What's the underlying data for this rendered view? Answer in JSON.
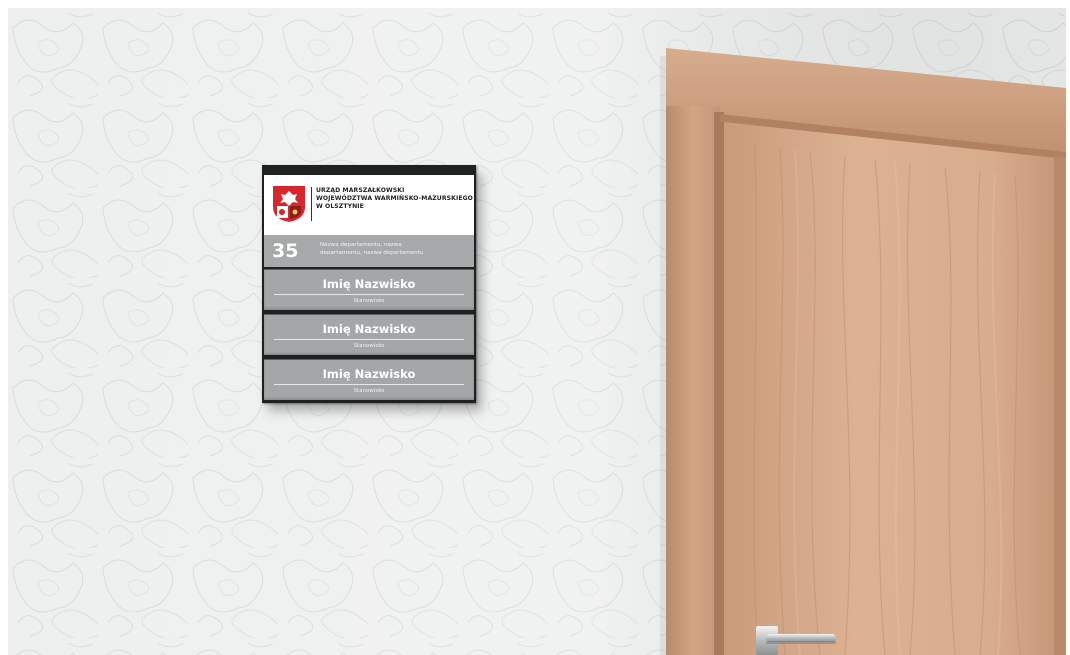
{
  "sign": {
    "institution_lines": [
      "URZĄD MARSZAŁKOWSKI",
      "WOJEWÓDZTWA WARMIŃSKO-MAZURSKIEGO",
      "W OLSZTYNIE"
    ],
    "room_number": "35",
    "department_lines": [
      "Nazwa departamentu, nazwa",
      "departamentu, nazwa departamentu"
    ],
    "panels": [
      {
        "name": "Imię Nazwisko",
        "role": "Stanowisko"
      },
      {
        "name": "Imię Nazwisko",
        "role": "Stanowisko"
      },
      {
        "name": "Imię Nazwisko",
        "role": "Stanowisko"
      }
    ]
  },
  "colors": {
    "wall": "#eef0ef",
    "sign_frame": "#1f2022",
    "panel_gray": "#a4a6a8",
    "crest_red": "#d7262d",
    "door_wood": "#d4a783",
    "frame_wood": "#c9997a"
  },
  "icons": {
    "crest": "coat-of-arms-icon",
    "handle": "door-handle-icon"
  }
}
